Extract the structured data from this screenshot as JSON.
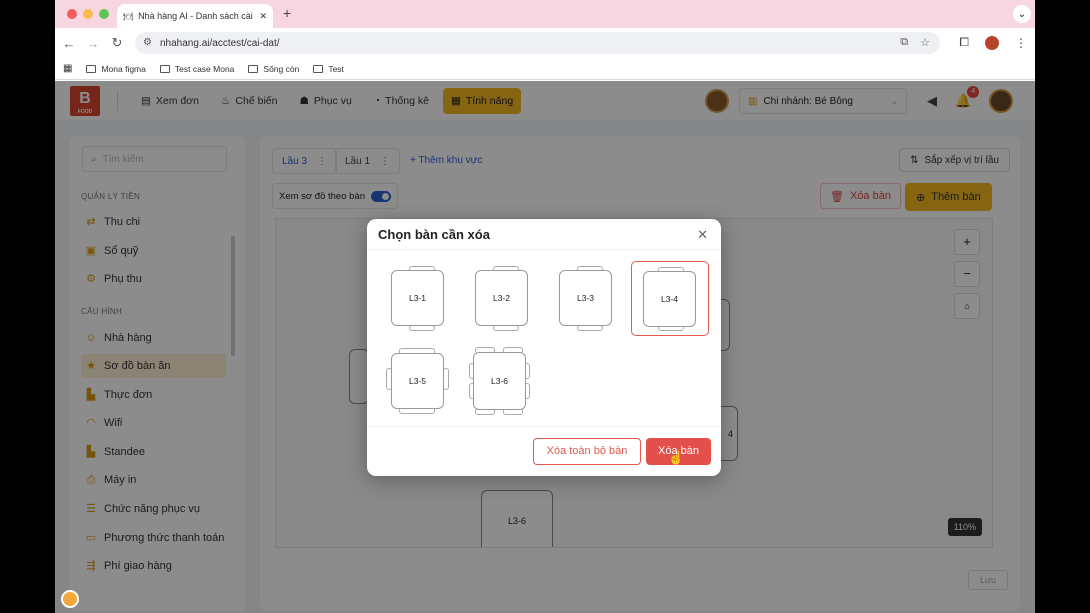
{
  "browser": {
    "tab_title": "Nhà hàng AI - Danh sách cài đặ",
    "new_tab": "+",
    "url": "nhahang.ai/acctest/cai-dat/",
    "bookmarks": [
      "Mona figma",
      "Test case Mona",
      "Sống còn",
      "Test"
    ]
  },
  "header": {
    "logo_text": "B",
    "logo_sub": "FOOD",
    "menu": [
      "Xem đơn",
      "Chế biến",
      "Phục vụ",
      "Thống kê",
      "Tính năng"
    ],
    "branch": "Chi nhánh: Bé Bông",
    "notif_count": "4"
  },
  "sidebar": {
    "search_placeholder": "Tìm kiếm",
    "section1": "QUẢN LÝ TIỀN",
    "items1": [
      "Thu chi",
      "Sổ quỹ",
      "Phụ thu"
    ],
    "section2": "CẤU HÌNH",
    "items2": [
      "Nhà hàng",
      "Sơ đồ bàn ăn",
      "Thực đơn",
      "Wifi",
      "Standee",
      "Máy in",
      "Chức năng phục vụ",
      "Phương thức thanh toán",
      "Phí giao hàng"
    ]
  },
  "main": {
    "tabs": [
      "Lầu 3",
      "Lầu 1"
    ],
    "add_zone": "+ Thêm khu vực",
    "sort_label": "Sắp xếp vị trí lầu",
    "toggle_label": "Xem sơ đồ theo bàn",
    "delete_label": "Xóa bàn",
    "add_label": "Thêm bàn",
    "zoom": "110%",
    "save_label": "Lưu",
    "bg_tables": [
      "L3-6",
      "4"
    ]
  },
  "modal": {
    "title": "Chọn bàn cần xóa",
    "tables": [
      "L3-1",
      "L3-2",
      "L3-3",
      "L3-4",
      "L3-5",
      "L3-6"
    ],
    "selected": "L3-4",
    "delete_all": "Xóa toàn bộ bàn",
    "delete": "Xóa bàn"
  },
  "colors": {
    "accent": "#f2b821",
    "danger": "#e3504b",
    "link": "#2f5fd1"
  }
}
